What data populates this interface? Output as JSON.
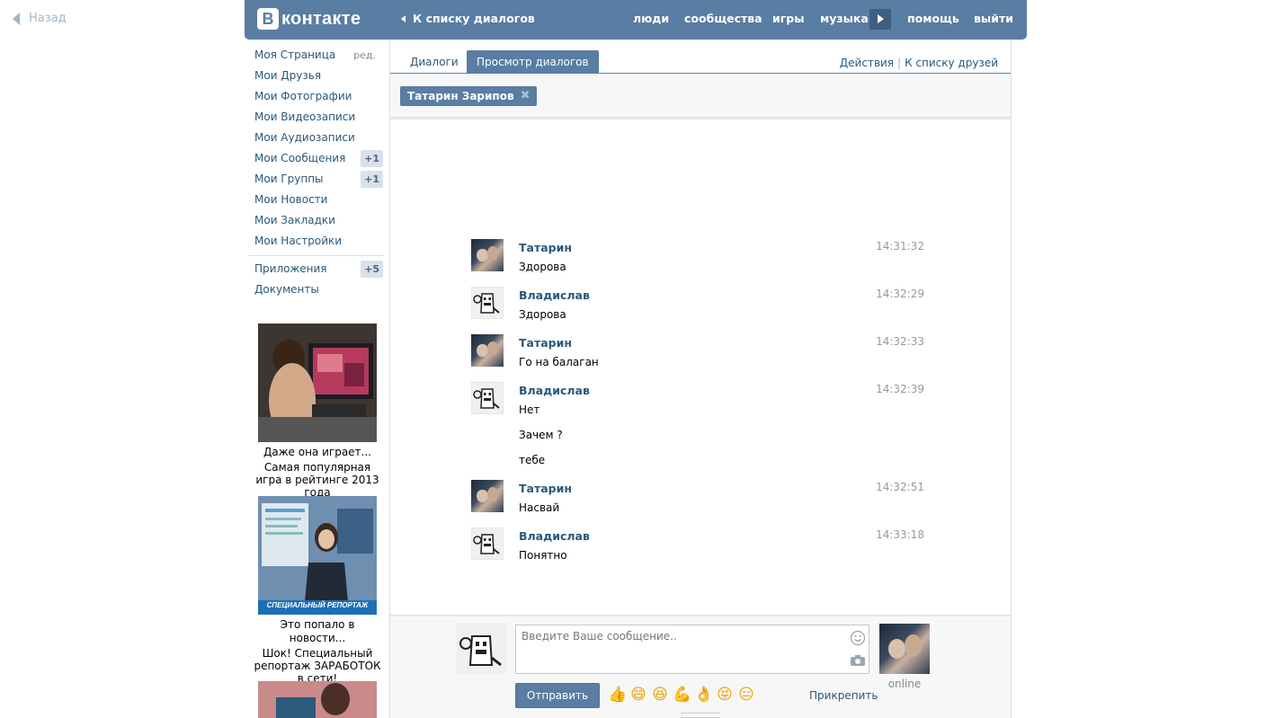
{
  "back": {
    "label": "Назад"
  },
  "header": {
    "logo_letter": "В",
    "logo_text": "контакте",
    "to_dialogs": "К списку диалогов",
    "nav": [
      "люди",
      "сообщества",
      "игры",
      "музыка",
      "помощь",
      "выйти"
    ]
  },
  "sidebar": {
    "edit_label": "ред.",
    "items": [
      {
        "label": "Моя Страница",
        "badge": ""
      },
      {
        "label": "Мои Друзья",
        "badge": ""
      },
      {
        "label": "Мои Фотографии",
        "badge": ""
      },
      {
        "label": "Мои Видеозаписи",
        "badge": ""
      },
      {
        "label": "Мои Аудиозаписи",
        "badge": ""
      },
      {
        "label": "Мои Сообщения",
        "badge": "+1"
      },
      {
        "label": "Мои Группы",
        "badge": "+1"
      },
      {
        "label": "Мои Новости",
        "badge": ""
      },
      {
        "label": "Мои Закладки",
        "badge": ""
      },
      {
        "label": "Мои Настройки",
        "badge": ""
      }
    ],
    "items2": [
      {
        "label": "Приложения",
        "badge": "+5"
      },
      {
        "label": "Документы",
        "badge": ""
      }
    ]
  },
  "ads": [
    {
      "title": "Даже она играет...",
      "text": "Самая популярная игра в рейтинге 2013 года"
    },
    {
      "title": "Это попало в новости...",
      "text": "Шок! Специальный репортаж ЗАРАБОТОК в сети!",
      "banner": "СПЕЦИАЛЬНЫЙ РЕПОРТАЖ"
    }
  ],
  "tabs": {
    "dialogs": "Диалоги",
    "view": "Просмотр диалогов",
    "actions": "Действия",
    "sep": "|",
    "friends": "К списку друзей"
  },
  "peer": {
    "name": "Татарин Зарипов",
    "remove": "✖"
  },
  "messages": [
    {
      "author": "Татарин",
      "time": "14:31:32",
      "lines": [
        "Здорова"
      ],
      "avatar": "photo"
    },
    {
      "author": "Владислав",
      "time": "14:32:29",
      "lines": [
        "Здорова"
      ],
      "avatar": "domo"
    },
    {
      "author": "Татарин",
      "time": "14:32:33",
      "lines": [
        "Го на балаган"
      ],
      "avatar": "photo"
    },
    {
      "author": "Владислав",
      "time": "14:32:39",
      "lines": [
        "Нет",
        "Зачем ?",
        "тебе"
      ],
      "avatar": "domo"
    },
    {
      "author": "Татарин",
      "time": "14:32:51",
      "lines": [
        "Насвай"
      ],
      "avatar": "photo"
    },
    {
      "author": "Владислав",
      "time": "14:33:18",
      "lines": [
        "Понятно"
      ],
      "avatar": "domo"
    }
  ],
  "composer": {
    "placeholder": "Введите Ваше сообщение..",
    "value": "",
    "send": "Отправить",
    "attach": "Прикрепить",
    "status": "online",
    "emojis": [
      "👍",
      "😄",
      "😆",
      "💪",
      "👌",
      "😝",
      "😑"
    ]
  },
  "colors": {
    "brand": "#597da3",
    "link": "#2b587a",
    "badge_bg": "#dae1e8"
  }
}
